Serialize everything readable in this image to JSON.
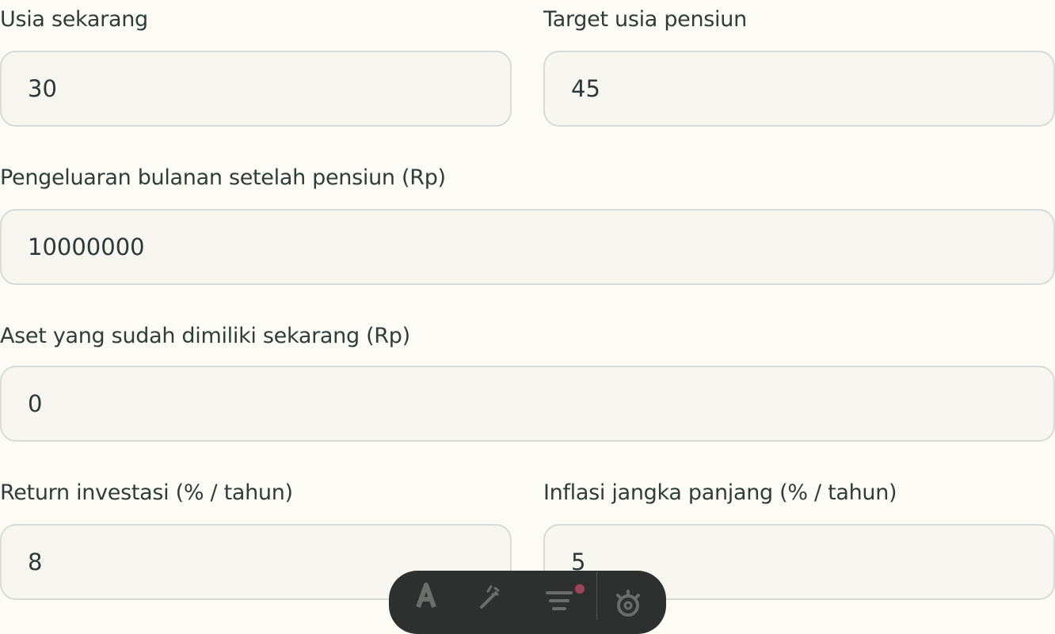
{
  "form": {
    "current_age": {
      "label": "Usia sekarang",
      "value": "30"
    },
    "retirement_age": {
      "label": "Target usia pensiun",
      "value": "45"
    },
    "monthly_expense": {
      "label": "Pengeluaran bulanan setelah pensiun (Rp)",
      "value": "10000000"
    },
    "current_assets": {
      "label": "Aset yang sudah dimiliki sekarang (Rp)",
      "value": "0"
    },
    "investment_return": {
      "label": "Return investasi (% / tahun)",
      "value": "8"
    },
    "inflation": {
      "label": "Inflasi jangka panjang (% / tahun)",
      "value": "5"
    }
  },
  "toolbar": {
    "buttons": [
      {
        "icon": "text-format-icon"
      },
      {
        "icon": "magic-wand-icon"
      },
      {
        "icon": "filter-lines-icon"
      },
      {
        "icon": "gear-icon"
      }
    ],
    "colors": {
      "background": "#2e302f",
      "icon": "#6b6d6b",
      "notification": "#a04457"
    }
  },
  "colors": {
    "page_background": "#fcfbf6",
    "input_background": "#f7f6f1",
    "input_border": "#d7dcd8",
    "text": "#2b3a36"
  }
}
